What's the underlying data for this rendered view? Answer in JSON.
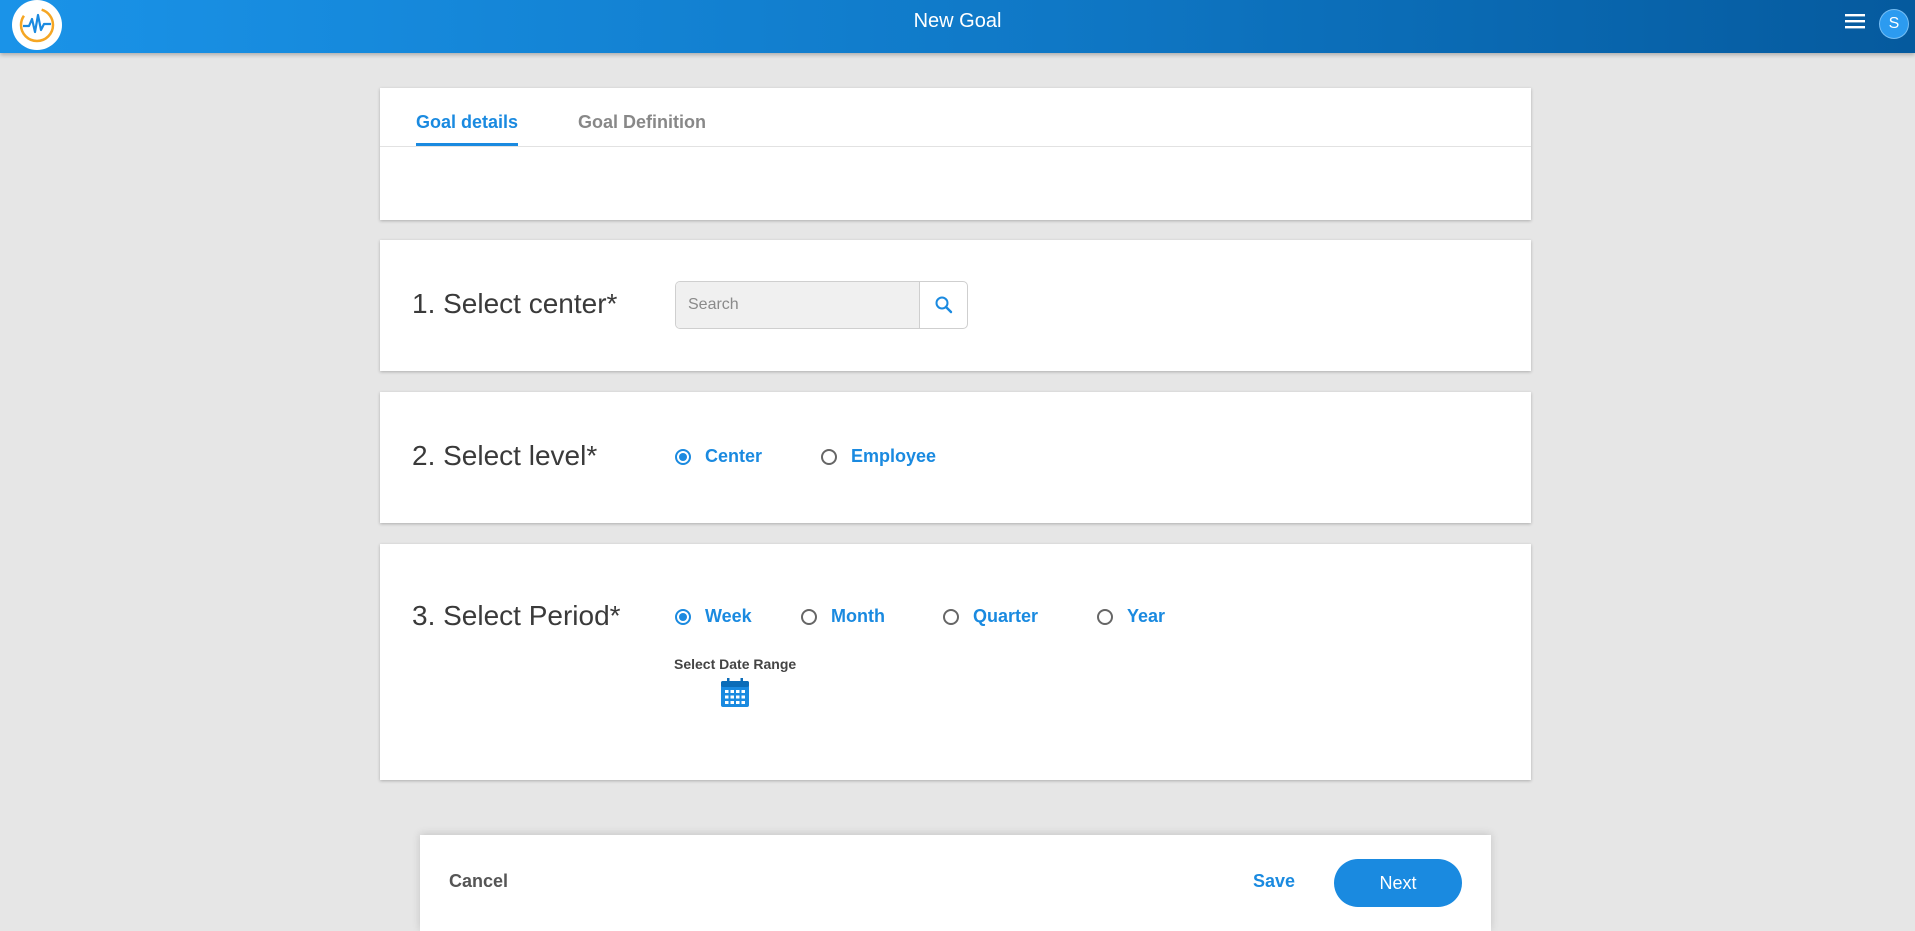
{
  "header": {
    "title": "New Goal",
    "avatar_initial": "S",
    "brand_color": "#1a8ae0"
  },
  "tabs": [
    {
      "label": "Goal details",
      "active": true
    },
    {
      "label": "Goal Definition",
      "active": false
    }
  ],
  "center_section": {
    "title": "1. Select center*",
    "search_placeholder": "Search",
    "search_value": ""
  },
  "level_section": {
    "title": "2. Select level*",
    "options": [
      {
        "label": "Center",
        "selected": true
      },
      {
        "label": "Employee",
        "selected": false
      }
    ]
  },
  "period_section": {
    "title": "3. Select Period*",
    "options": [
      {
        "label": "Week",
        "selected": true
      },
      {
        "label": "Month",
        "selected": false
      },
      {
        "label": "Quarter",
        "selected": false
      },
      {
        "label": "Year",
        "selected": false
      }
    ],
    "date_range_label": "Select Date Range"
  },
  "footer": {
    "cancel_label": "Cancel",
    "save_label": "Save",
    "next_label": "Next"
  },
  "icons": {
    "logo": "heartbeat-logo-icon",
    "menu": "hamburger-menu-icon",
    "search": "search-icon",
    "calendar": "calendar-icon"
  }
}
